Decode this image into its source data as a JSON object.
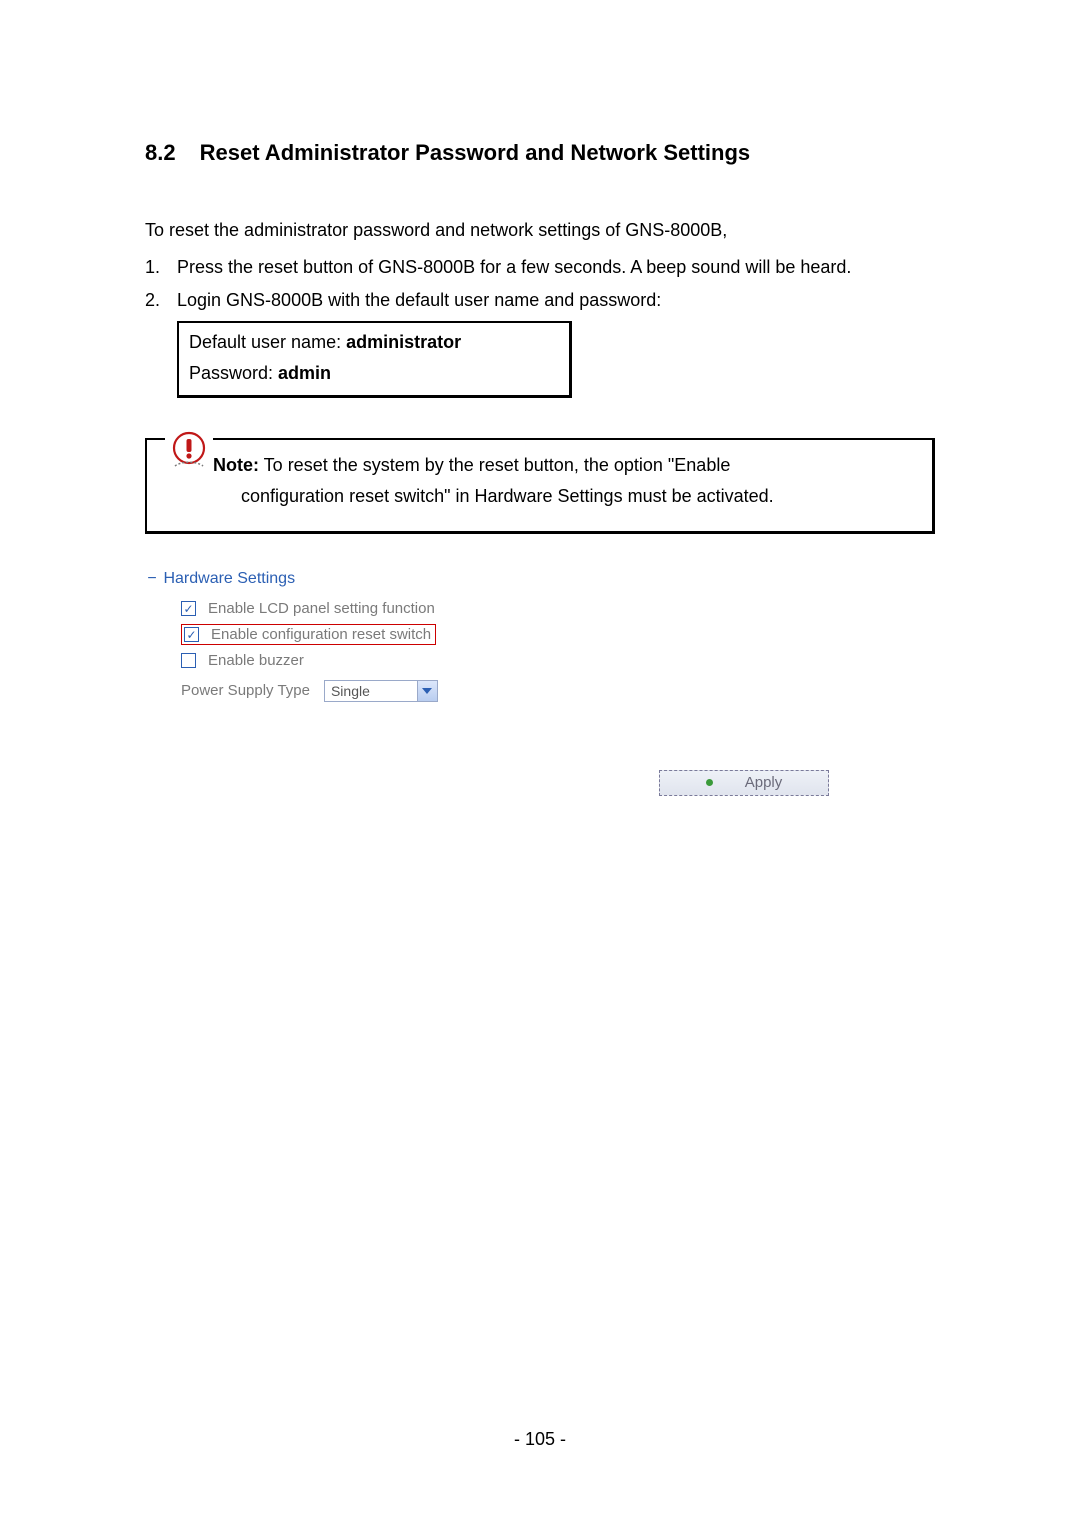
{
  "section": {
    "number": "8.2",
    "title": "Reset Administrator Password and Network Settings"
  },
  "intro": "To reset the administrator password and network settings of GNS-8000B,",
  "steps": {
    "s1": {
      "num": "1.",
      "text": "Press the reset button of GNS-8000B for a few seconds.  A beep sound will be heard."
    },
    "s2": {
      "num": "2.",
      "text": "Login GNS-8000B with the default user name and password:"
    }
  },
  "credentials": {
    "user_label": "Default user name: ",
    "user_value": "administrator",
    "pass_label": "Password: ",
    "pass_value": "admin"
  },
  "note": {
    "label": "Note:",
    "line1": " To reset the system by the reset button, the option \"Enable",
    "line2": "configuration reset switch\" in Hardware Settings must be activated."
  },
  "hardware": {
    "title": "Hardware Settings",
    "opt_lcd": "Enable LCD panel setting function",
    "opt_reset": "Enable configuration reset switch",
    "opt_buzzer": "Enable buzzer",
    "ps_label": "Power Supply Type",
    "ps_value": "Single",
    "apply": "Apply"
  },
  "page_number": "- 105 -"
}
